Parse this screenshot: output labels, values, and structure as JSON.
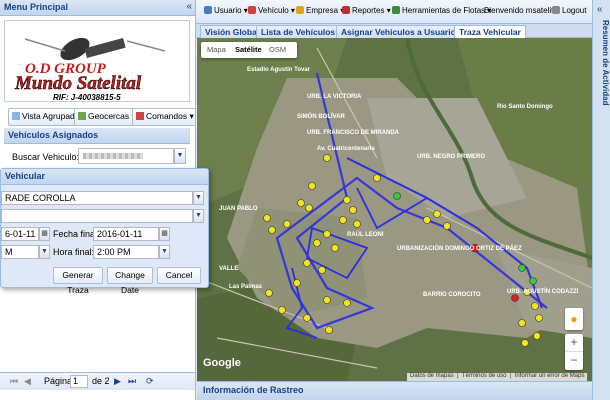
{
  "left": {
    "title": "Menu Principal",
    "logo": {
      "line1": "O.D GROUP",
      "line2": "Mundo Satelital",
      "rif": "RIF: J-40038815-5"
    },
    "toolbar": {
      "vista": "Vista Agrupada",
      "geocercas": "Geocercas",
      "comandos": "Comandos"
    },
    "vehicles_header": "Vehículos Asignados",
    "search_label": "Buscar Vehiculo:",
    "pager": {
      "page_label": "Página",
      "page_value": "1",
      "of_label": "de 2"
    }
  },
  "dialog": {
    "title": "Vehicular",
    "vehicle_value": "RADE COROLLA",
    "start_date": "6-01-11",
    "start_time": "M",
    "end_date_label": "Fecha final:",
    "end_date": "2016-01-11",
    "end_time_label": "Hora final:",
    "end_time": "2:00 PM",
    "btn_generate": "Generar Traza",
    "btn_change": "Change Date",
    "btn_cancel": "Cancel"
  },
  "topbar": {
    "usuario": "Usuario",
    "vehiculo": "Vehículo",
    "empresa": "Empresa",
    "reportes": "Reportes",
    "herramientas": "Herramientas de Flotas",
    "welcome": "Bienvenido msatelital",
    "logout": "Logout"
  },
  "tabs": [
    "Visión Global",
    "Lista de Vehículos",
    "Asignar Vehiculos a Usuarios",
    "Traza Vehicular"
  ],
  "map": {
    "types": [
      "Mapa",
      "Satélite",
      "OSM"
    ],
    "labels": {
      "estadio": "Estadio Agustín Tovar",
      "victoria": "URB. LA VICTORIA",
      "simon": "SIMÓN BOLÍVAR",
      "francisco": "URB. FRANCISCO DE MIRANDA",
      "negro": "URB. NEGRO PRIMERO",
      "cuatricentenaria": "Av. Cuatricentenaria",
      "juan_pablo": "JUAN PABLO",
      "raul": "RAÚL LEONI",
      "urbanizacion": "URBANIZACIÓN DOMINGO ORTIZ DE PÁEZ",
      "camiri": "BARRIO COROCITO",
      "agustin": "URB. AGUSTÍN CODAZZI",
      "palmas": "Las Palmas",
      "valle": "VALLE",
      "rio": "Río Santo Domingo",
      "google": "Google",
      "footer_data": "Datos de mapas",
      "footer_terms": "Términos de uso",
      "footer_report": "Informar un error de Maps"
    }
  },
  "bottom_title": "Información de Rastreo",
  "right_title": "Resumen de Actividad",
  "colors": {
    "accent": "#15428b",
    "route": "#2a2ee0",
    "marker_yellow": "#f2e51e",
    "marker_green": "#3cc83c",
    "marker_red": "#e02020"
  }
}
